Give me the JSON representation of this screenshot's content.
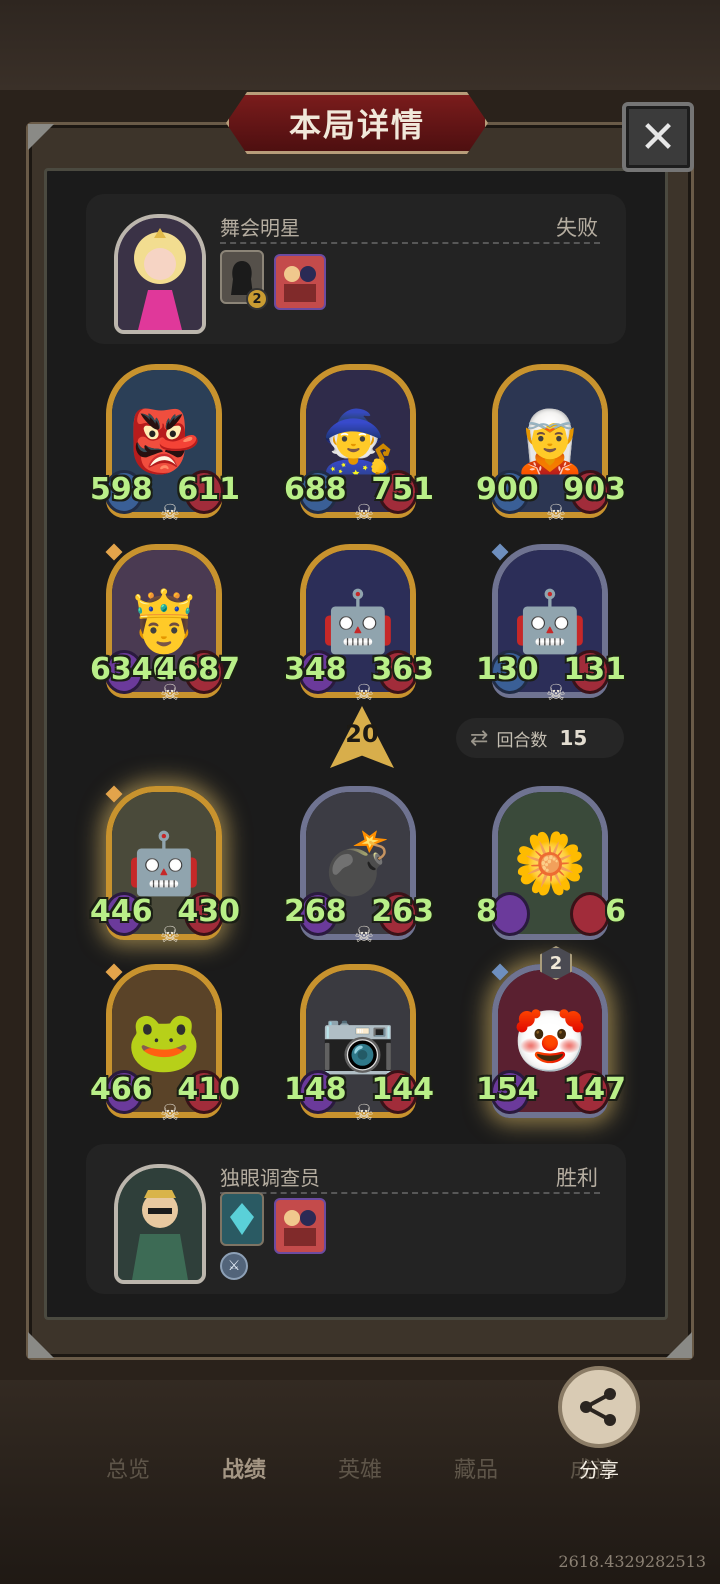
{
  "dialog": {
    "title": "本局详情",
    "close_symbol": "✕"
  },
  "opponent": {
    "name": "舞会明星",
    "result": "失败",
    "icons": [
      {
        "name": "shadow-hero-icon",
        "badge": "2"
      },
      {
        "name": "minions-pack-icon"
      }
    ]
  },
  "player": {
    "name": "独眼调查员",
    "result": "胜利",
    "icons": [
      {
        "name": "crystal-trinket-icon"
      },
      {
        "name": "minions-pack-icon"
      },
      {
        "name": "sword-trinket-icon"
      }
    ]
  },
  "opponent_board": [
    {
      "name": "blue-goblin-minion",
      "atk": "598",
      "hp": "611",
      "frame": "gold"
    },
    {
      "name": "star-wizard-minion",
      "atk": "688",
      "hp": "751",
      "frame": "gold"
    },
    {
      "name": "blue-haired-elf-minion",
      "atk": "900",
      "hp": "903",
      "frame": "gold"
    },
    {
      "name": "bearded-king-minion",
      "atk": "6340",
      "hp": "4687",
      "frame": "gold"
    },
    {
      "name": "cosmic-golem-minion",
      "atk": "348",
      "hp": "363",
      "frame": "gold"
    },
    {
      "name": "cosmic-golem-minion-2",
      "atk": "130",
      "hp": "131",
      "frame": "silver"
    }
  ],
  "player_board": [
    {
      "name": "steam-robot-minion",
      "atk": "446",
      "hp": "430",
      "frame": "gold"
    },
    {
      "name": "bomb-knight-minion",
      "atk": "268",
      "hp": "263",
      "frame": "silver"
    },
    {
      "name": "singing-flower-minion",
      "atk": "8",
      "hp": "6",
      "frame": "silver"
    },
    {
      "name": "toad-minion",
      "atk": "466",
      "hp": "410",
      "frame": "gold"
    },
    {
      "name": "camera-robot-minion",
      "atk": "148",
      "hp": "144",
      "frame": "gold"
    },
    {
      "name": "jester-minion",
      "atk": "154",
      "hp": "147",
      "frame": "silver"
    }
  ],
  "tier": "20",
  "rounds": {
    "label": "回合数",
    "value": "15"
  },
  "tier_badge_jester": "2",
  "nav": {
    "tabs": [
      "总览",
      "战绩",
      "英雄",
      "藏品",
      "成就"
    ],
    "active": "战绩"
  },
  "share": {
    "label": "分享"
  },
  "build": "2618.4329282513"
}
